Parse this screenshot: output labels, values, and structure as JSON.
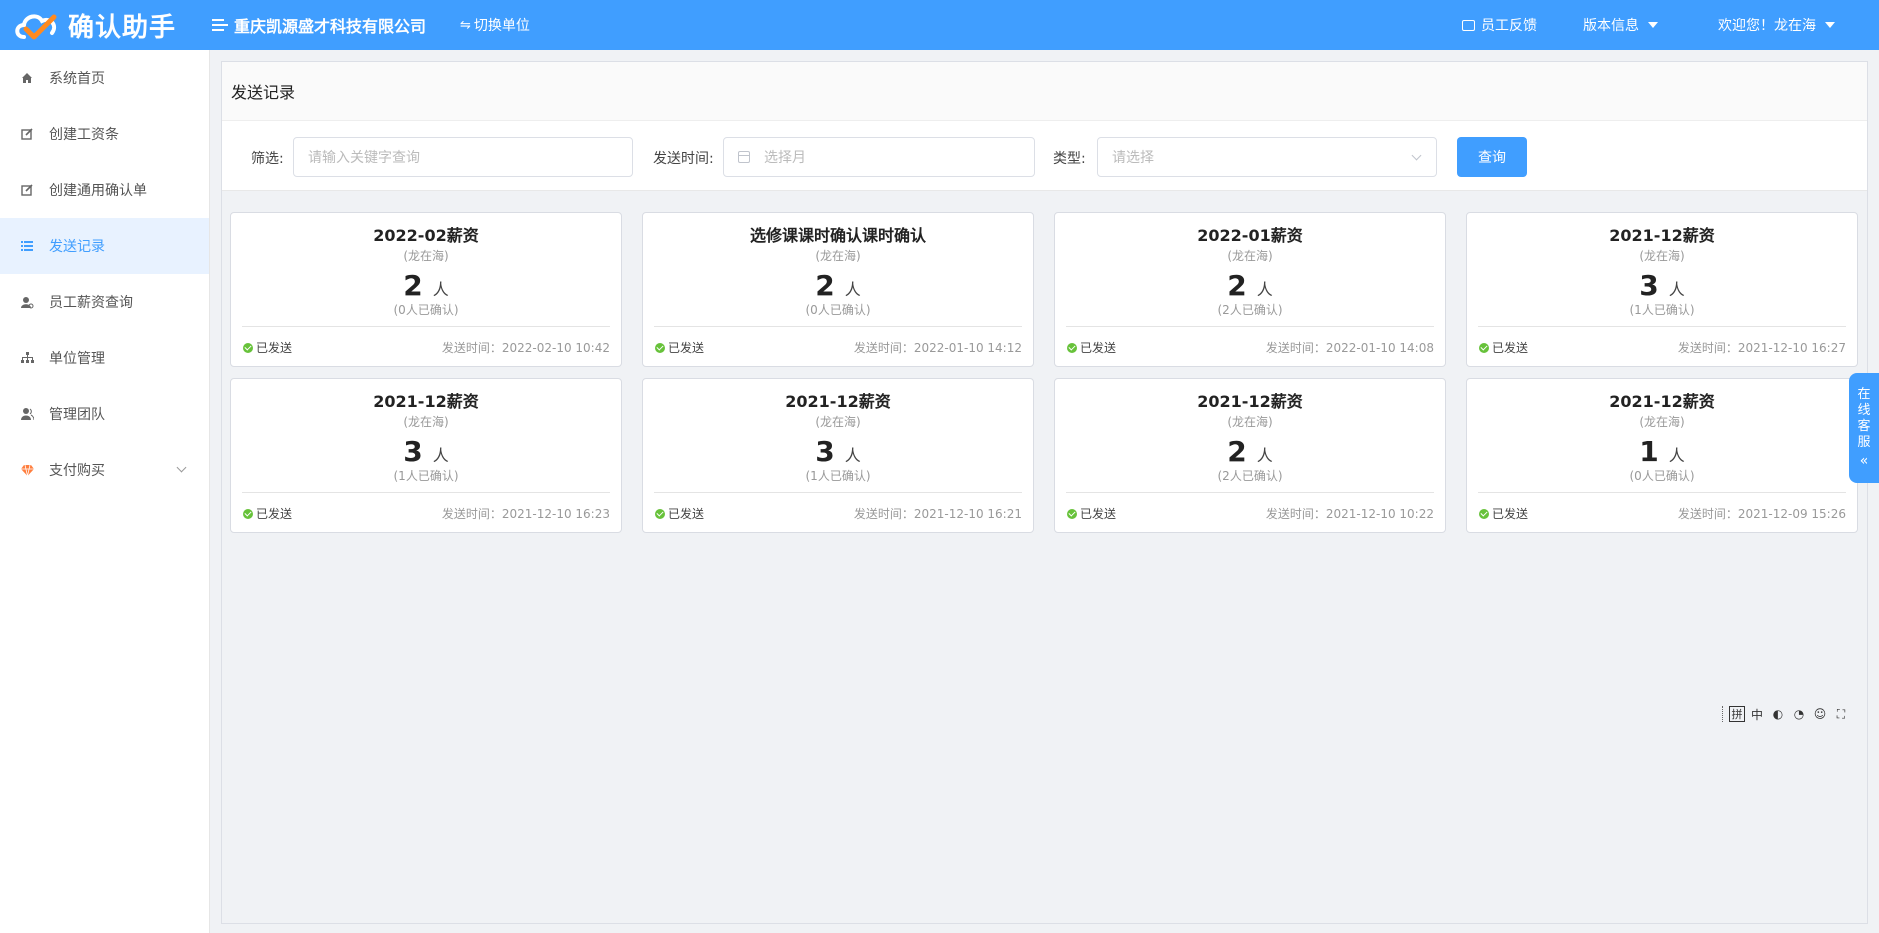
{
  "header": {
    "logo_text": "确认助手",
    "company": "重庆凯源盛才科技有限公司",
    "switch_label": "切换单位",
    "feedback_label": "员工反馈",
    "version_label": "版本信息",
    "welcome_label": "欢迎您！龙在海",
    "bg_color": "#409eff"
  },
  "sidebar": {
    "items": [
      {
        "label": "系统首页",
        "icon": "home-icon"
      },
      {
        "label": "创建工资条",
        "icon": "edit-icon"
      },
      {
        "label": "创建通用确认单",
        "icon": "edit-icon"
      },
      {
        "label": "发送记录",
        "icon": "list-icon",
        "active": true
      },
      {
        "label": "员工薪资查询",
        "icon": "user-search-icon"
      },
      {
        "label": "单位管理",
        "icon": "org-icon"
      },
      {
        "label": "管理团队",
        "icon": "team-icon"
      },
      {
        "label": "支付购买",
        "icon": "diamond-icon",
        "expandable": true
      }
    ]
  },
  "page": {
    "title": "发送记录"
  },
  "filters": {
    "keyword_label": "筛选:",
    "keyword_placeholder": "请输入关键字查询",
    "time_label": "发送时间:",
    "time_placeholder": "选择月",
    "type_label": "类型:",
    "type_placeholder": "请选择",
    "query_button": "查询"
  },
  "cards": [
    {
      "title": "2022-02薪资",
      "creator": "(龙在海)",
      "count": "2",
      "unit": "人",
      "confirmed": "(0人已确认)",
      "status": "已发送",
      "time": "发送时间：2022-02-10 10:42"
    },
    {
      "title": "选修课课时确认课时确认",
      "creator": "(龙在海)",
      "count": "2",
      "unit": "人",
      "confirmed": "(0人已确认)",
      "status": "已发送",
      "time": "发送时间：2022-01-10 14:12"
    },
    {
      "title": "2022-01薪资",
      "creator": "(龙在海)",
      "count": "2",
      "unit": "人",
      "confirmed": "(2人已确认)",
      "status": "已发送",
      "time": "发送时间：2022-01-10 14:08"
    },
    {
      "title": "2021-12薪资",
      "creator": "(龙在海)",
      "count": "3",
      "unit": "人",
      "confirmed": "(1人已确认)",
      "status": "已发送",
      "time": "发送时间：2021-12-10 16:27"
    },
    {
      "title": "2021-12薪资",
      "creator": "(龙在海)",
      "count": "3",
      "unit": "人",
      "confirmed": "(1人已确认)",
      "status": "已发送",
      "time": "发送时间：2021-12-10 16:23"
    },
    {
      "title": "2021-12薪资",
      "creator": "(龙在海)",
      "count": "3",
      "unit": "人",
      "confirmed": "(1人已确认)",
      "status": "已发送",
      "time": "发送时间：2021-12-10 16:21"
    },
    {
      "title": "2021-12薪资",
      "creator": "(龙在海)",
      "count": "2",
      "unit": "人",
      "confirmed": "(2人已确认)",
      "status": "已发送",
      "time": "发送时间：2021-12-10 10:22"
    },
    {
      "title": "2021-12薪资",
      "creator": "(龙在海)",
      "count": "1",
      "unit": "人",
      "confirmed": "(0人已确认)",
      "status": "已发送",
      "time": "发送时间：2021-12-09 15:26"
    }
  ],
  "float_service": {
    "label_chars": [
      "在",
      "线",
      "客",
      "服"
    ],
    "arrow": "«"
  },
  "ime_toolbar": {
    "pin_label": "拼"
  }
}
